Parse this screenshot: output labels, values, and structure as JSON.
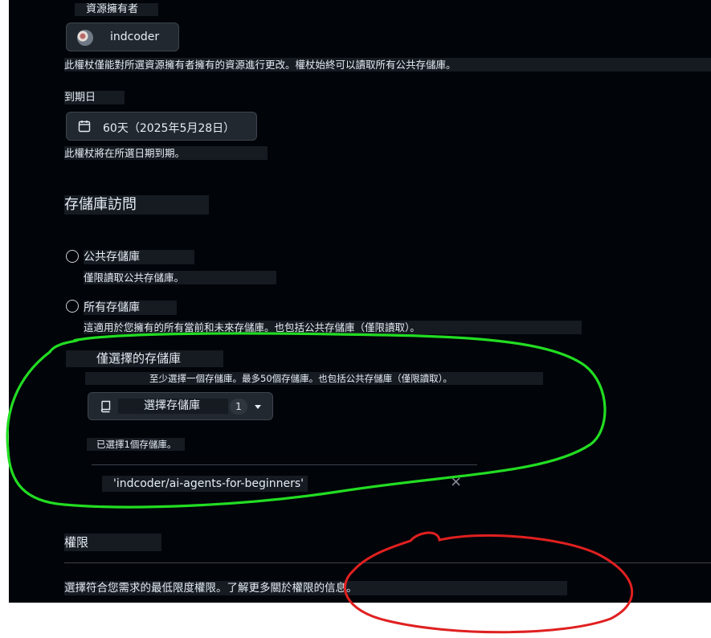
{
  "owner": {
    "label": "資源擁有者",
    "selected": "indcoder",
    "note": "此權杖僅能對所選資源擁有者擁有的資源進行更改。權杖始終可以讀取所有公共存儲庫。"
  },
  "expiration": {
    "label": "到期日",
    "value": "60天（2025年5月28日）",
    "note": "此權杖將在所選日期到期。"
  },
  "repo_access": {
    "heading": "存儲庫訪問",
    "options": [
      {
        "label": "公共存儲庫",
        "desc": "僅限讀取公共存儲庫。"
      },
      {
        "label": "所有存儲庫",
        "desc": "這適用於您擁有的所有當前和未來存儲庫。也包括公共存儲庫（僅限讀取）。"
      },
      {
        "label": "僅選擇的存儲庫",
        "desc": "至少選擇一個存儲庫。最多50個存儲庫。也包括公共存儲庫（僅限讀取）。"
      }
    ],
    "select_button": {
      "label": "選擇存儲庫",
      "count": "1"
    },
    "selected_count_text": "已選擇1個存儲庫。",
    "selected_repos": [
      "'indcoder/ai-agents-for-beginners'"
    ],
    "remove_symbol": "×"
  },
  "permissions": {
    "heading": "權限",
    "note": "選擇符合您需求的最低限度權限。了解更多關於權限的信息。"
  },
  "colors": {
    "background": "#010409",
    "text": "#e6edf3",
    "border": "#3d444d",
    "annotation_green": "#22dd22",
    "annotation_red": "#e02020"
  }
}
